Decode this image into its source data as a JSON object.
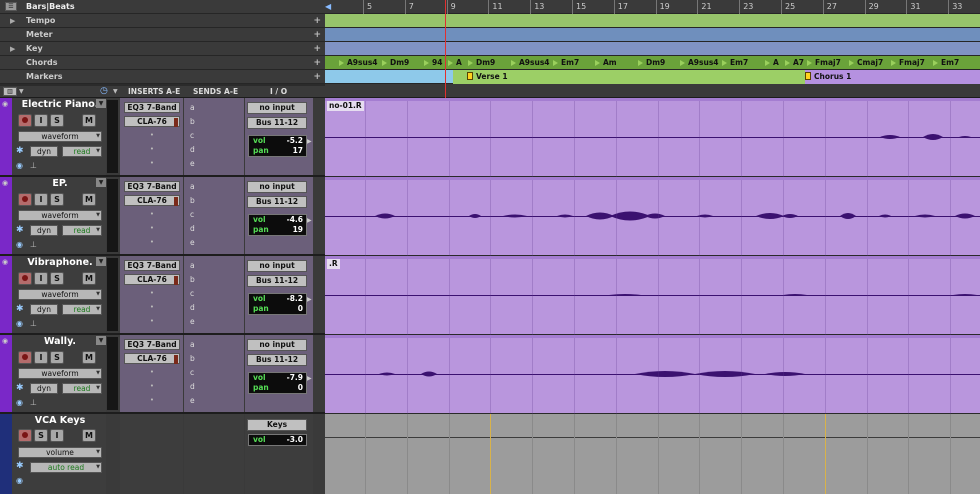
{
  "rulers": {
    "timebase": "Bars|Beats",
    "rows": [
      "Tempo",
      "Meter",
      "Key",
      "Chords",
      "Markers"
    ]
  },
  "bar_numbers": [
    "5",
    "7",
    "9",
    "11",
    "13",
    "15",
    "17",
    "19",
    "21",
    "23",
    "25",
    "27",
    "29",
    "31",
    "33"
  ],
  "chords": [
    "A9sus4",
    "Dm9",
    "94",
    "A",
    "Dm9",
    "A9sus4",
    "Em7",
    "Am",
    "Dm9",
    "A9sus4",
    "Em7",
    "A",
    "A7",
    "Fmaj7",
    "Cmaj7",
    "Fmaj7",
    "Em7"
  ],
  "markers": [
    "Verse 1",
    "Chorus 1"
  ],
  "columns": {
    "inserts": "INSERTS A-E",
    "sends": "SENDS A-E",
    "io": "I / O"
  },
  "tracks": [
    {
      "name": "Electric Piano.",
      "view": "waveform",
      "dyn": "dyn",
      "auto": "read",
      "inserts": [
        "EQ3 7-Band",
        "CLA-76"
      ],
      "sends": [
        "a",
        "b",
        "c",
        "d",
        "e"
      ],
      "input": "no input",
      "output": "Bus 11-12",
      "vol_label": "vol",
      "vol": "-5.2",
      "pan_label": "pan",
      "pan": "17",
      "clip": "no-01.R"
    },
    {
      "name": "EP.",
      "view": "waveform",
      "dyn": "dyn",
      "auto": "read",
      "inserts": [
        "EQ3 7-Band",
        "CLA-76"
      ],
      "sends": [
        "a",
        "b",
        "c",
        "d",
        "e"
      ],
      "input": "no input",
      "output": "Bus 11-12",
      "vol_label": "vol",
      "vol": "-4.6",
      "pan_label": "pan",
      "pan": "19",
      "clip": ""
    },
    {
      "name": "Vibraphone.",
      "view": "waveform",
      "dyn": "dyn",
      "auto": "read",
      "inserts": [
        "EQ3 7-Band",
        "CLA-76"
      ],
      "sends": [
        "a",
        "b",
        "c",
        "d",
        "e"
      ],
      "input": "no input",
      "output": "Bus 11-12",
      "vol_label": "vol",
      "vol": "-8.2",
      "pan_label": "pan",
      "pan": "0",
      "clip": ".R"
    },
    {
      "name": "Wally.",
      "view": "waveform",
      "dyn": "dyn",
      "auto": "read",
      "inserts": [
        "EQ3 7-Band",
        "CLA-76"
      ],
      "sends": [
        "a",
        "b",
        "c",
        "d",
        "e"
      ],
      "input": "no input",
      "output": "Bus 11-12",
      "vol_label": "vol",
      "vol": "-7.9",
      "pan_label": "pan",
      "pan": "0",
      "clip": ""
    }
  ],
  "vca": {
    "name": "VCA Keys",
    "view": "volume",
    "auto": "auto read",
    "group": "Keys",
    "vol_label": "vol",
    "vol": "-3.0"
  },
  "colors": {
    "track_accent": "#7a28c8",
    "clip": "#b996dd",
    "waveform": "#3b1170",
    "chords_ruler": "#6aa23a",
    "markers_ruler": "#8ec9ea",
    "playhead": "#e03030"
  }
}
